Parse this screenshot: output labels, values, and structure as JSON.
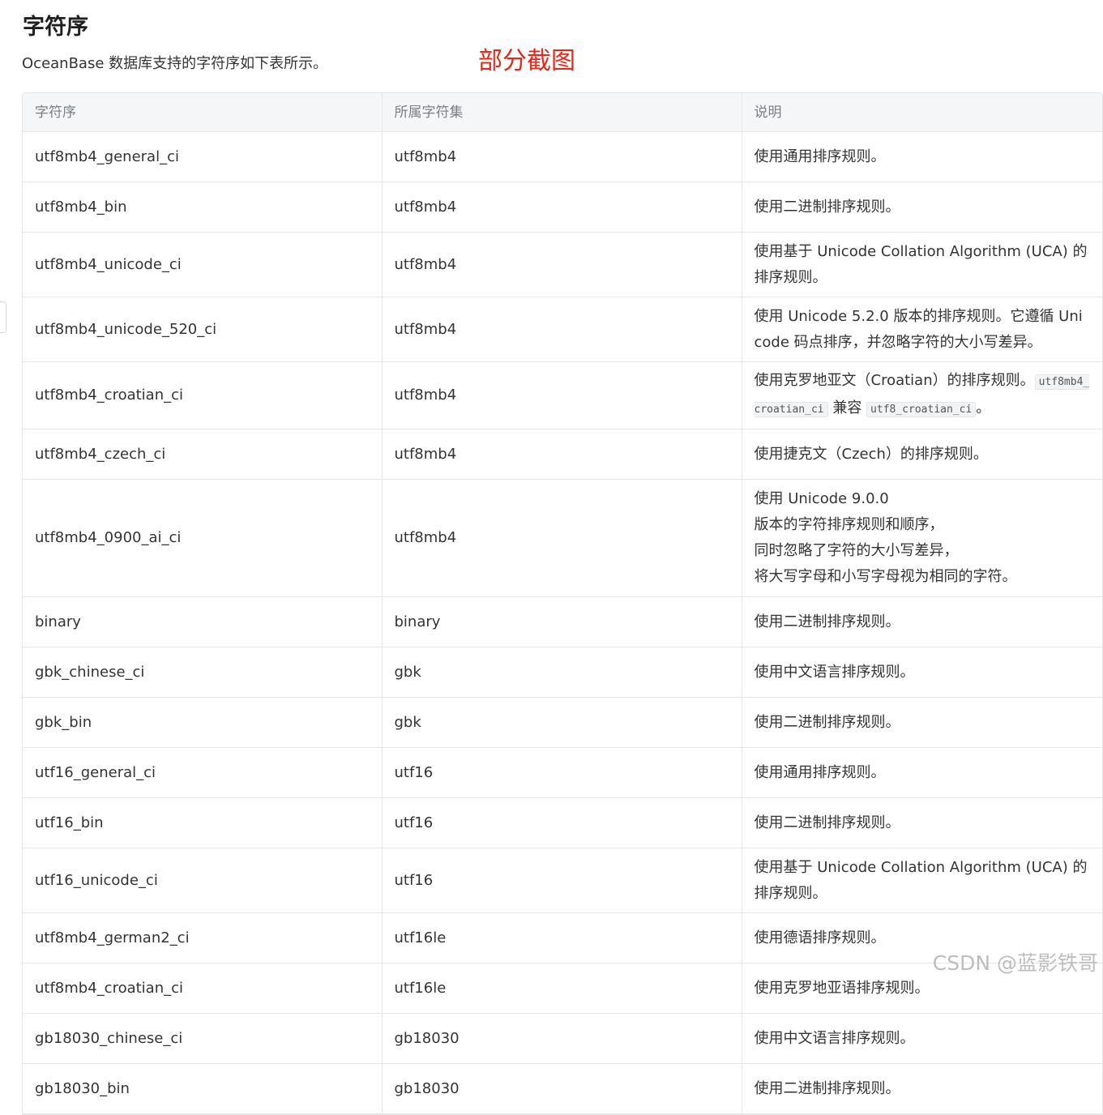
{
  "header": {
    "title": "字符序",
    "intro": "OceanBase 数据库支持的字符序如下表所示。",
    "annotation": "部分截图"
  },
  "table": {
    "columns": [
      "字符序",
      "所属字符集",
      "说明"
    ],
    "rows": [
      {
        "collation": "utf8mb4_general_ci",
        "charset": "utf8mb4",
        "desc": [
          "使用通用排序规则。"
        ]
      },
      {
        "collation": "utf8mb4_bin",
        "charset": "utf8mb4",
        "desc": [
          "使用二进制排序规则。"
        ]
      },
      {
        "collation": "utf8mb4_unicode_ci",
        "charset": "utf8mb4",
        "desc": [
          "使用基于 Unicode Collation Algorithm (UCA) 的排序规则。"
        ]
      },
      {
        "collation": "utf8mb4_unicode_520_ci",
        "charset": "utf8mb4",
        "desc": [
          "使用 Unicode 5.2.0 版本的排序规则。它遵循 Unicode 码点排序，并忽略字符的大小写差异。"
        ]
      },
      {
        "collation": "utf8mb4_croatian_ci",
        "charset": "utf8mb4",
        "desc_parts": {
          "before": "使用克罗地亚文（Croatian）的排序规则。",
          "code1": "utf8mb4_croatian_ci",
          "middle": " 兼容 ",
          "code2": "utf8_croatian_ci",
          "after": "。"
        }
      },
      {
        "collation": "utf8mb4_czech_ci",
        "charset": "utf8mb4",
        "desc": [
          "使用捷克文（Czech）的排序规则。"
        ]
      },
      {
        "collation": "utf8mb4_0900_ai_ci",
        "charset": "utf8mb4",
        "desc": [
          "使用 Unicode 9.0.0",
          "版本的字符排序规则和顺序，",
          "同时忽略了字符的大小写差异，",
          "将大写字母和小写字母视为相同的字符。"
        ]
      },
      {
        "collation": "binary",
        "charset": "binary",
        "desc": [
          "使用二进制排序规则。"
        ]
      },
      {
        "collation": "gbk_chinese_ci",
        "charset": "gbk",
        "desc": [
          "使用中文语言排序规则。"
        ]
      },
      {
        "collation": "gbk_bin",
        "charset": "gbk",
        "desc": [
          "使用二进制排序规则。"
        ]
      },
      {
        "collation": "utf16_general_ci",
        "charset": "utf16",
        "desc": [
          "使用通用排序规则。"
        ]
      },
      {
        "collation": "utf16_bin",
        "charset": "utf16",
        "desc": [
          "使用二进制排序规则。"
        ]
      },
      {
        "collation": "utf16_unicode_ci",
        "charset": "utf16",
        "desc": [
          "使用基于 Unicode Collation Algorithm (UCA) 的排序规则。"
        ]
      },
      {
        "collation": "utf8mb4_german2_ci",
        "charset": "utf16le",
        "desc": [
          "使用德语排序规则。"
        ]
      },
      {
        "collation": "utf8mb4_croatian_ci",
        "charset": "utf16le",
        "desc": [
          "使用克罗地亚语排序规则。"
        ]
      },
      {
        "collation": "gb18030_chinese_ci",
        "charset": "gb18030",
        "desc": [
          "使用中文语言排序规则。"
        ]
      },
      {
        "collation": "gb18030_bin",
        "charset": "gb18030",
        "desc": [
          "使用二进制排序规则。"
        ]
      }
    ]
  },
  "watermark": "CSDN @蓝影铁哥"
}
